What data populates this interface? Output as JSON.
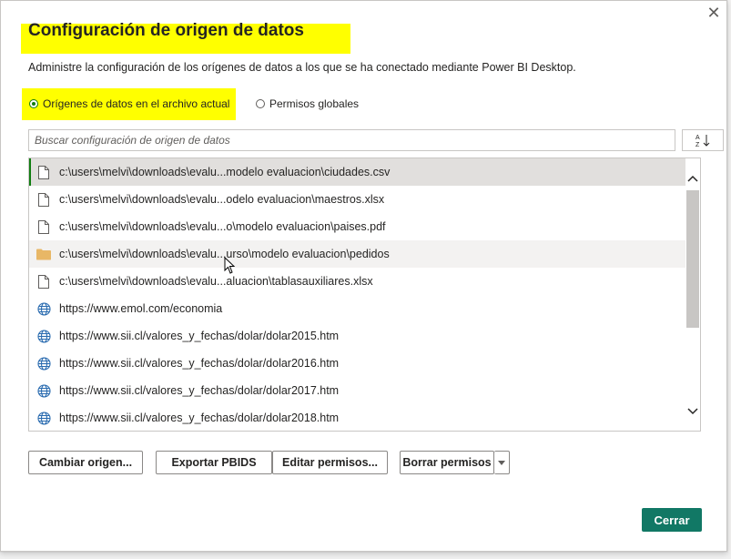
{
  "dialog": {
    "title": "Configuración de origen de datos",
    "subtitle": "Administre la configuración de los orígenes de datos a los que se ha conectado mediante Power BI Desktop.",
    "close_icon": "close-icon"
  },
  "scope": {
    "options": [
      {
        "label": "Orígenes de datos en el archivo actual",
        "selected": true
      },
      {
        "label": "Permisos globales",
        "selected": false
      }
    ]
  },
  "search": {
    "placeholder": "Buscar configuración de origen de datos",
    "value": "",
    "sort_icon": "sort-az-icon"
  },
  "sources": [
    {
      "icon": "file-icon",
      "path": "c:\\users\\melvi\\downloads\\evalu...modelo evaluacion\\ciudades.csv",
      "state": "selected"
    },
    {
      "icon": "file-icon",
      "path": "c:\\users\\melvi\\downloads\\evalu...odelo evaluacion\\maestros.xlsx",
      "state": ""
    },
    {
      "icon": "file-icon",
      "path": "c:\\users\\melvi\\downloads\\evalu...o\\modelo evaluacion\\paises.pdf",
      "state": ""
    },
    {
      "icon": "folder-icon",
      "path": "c:\\users\\melvi\\downloads\\evalu...urso\\modelo evaluacion\\pedidos",
      "state": "hover"
    },
    {
      "icon": "file-icon",
      "path": "c:\\users\\melvi\\downloads\\evalu...aluacion\\tablasauxiliares.xlsx",
      "state": ""
    },
    {
      "icon": "globe-icon",
      "path": "https://www.emol.com/economia",
      "state": ""
    },
    {
      "icon": "globe-icon",
      "path": "https://www.sii.cl/valores_y_fechas/dolar/dolar2015.htm",
      "state": ""
    },
    {
      "icon": "globe-icon",
      "path": "https://www.sii.cl/valores_y_fechas/dolar/dolar2016.htm",
      "state": ""
    },
    {
      "icon": "globe-icon",
      "path": "https://www.sii.cl/valores_y_fechas/dolar/dolar2017.htm",
      "state": ""
    },
    {
      "icon": "globe-icon",
      "path": "https://www.sii.cl/valores_y_fechas/dolar/dolar2018.htm",
      "state": ""
    }
  ],
  "buttons": {
    "cambiar": "Cambiar origen...",
    "exportar": "Exportar PBIDS",
    "editar": "Editar permisos...",
    "borrar": "Borrar permisos",
    "cerrar": "Cerrar"
  },
  "colors": {
    "accent": "#117865",
    "radio": "#107c10",
    "highlight": "#ffff00"
  }
}
